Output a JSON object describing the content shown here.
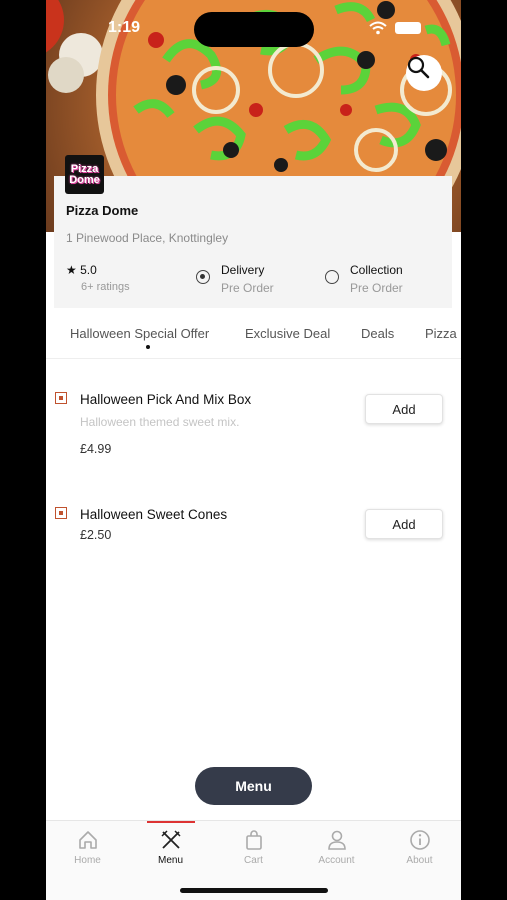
{
  "status": {
    "time": "1:19"
  },
  "restaurant": {
    "logo_text": "Pizza Dome",
    "name": "Pizza Dome",
    "address": "1 Pinewood Place, Knottingley",
    "rating": "5.0",
    "rating_count": "6+ ratings"
  },
  "order_options": [
    {
      "title": "Delivery",
      "subtitle": "Pre Order",
      "selected": true
    },
    {
      "title": "Collection",
      "subtitle": "Pre Order",
      "selected": false
    }
  ],
  "categories": [
    "Halloween Special Offer",
    "Exclusive Deal",
    "Deals",
    "Pizza"
  ],
  "items": [
    {
      "name": "Halloween Pick And Mix Box",
      "description": "Halloween themed sweet mix.",
      "price": "£4.99",
      "button": "Add"
    },
    {
      "name": "Halloween Sweet Cones",
      "description": "",
      "price": "£2.50",
      "button": "Add"
    }
  ],
  "menu_button": "Menu",
  "nav": [
    {
      "label": "Home",
      "icon": "home-icon"
    },
    {
      "label": "Menu",
      "icon": "cutlery-icon",
      "active": true
    },
    {
      "label": "Cart",
      "icon": "bag-icon"
    },
    {
      "label": "Account",
      "icon": "user-icon"
    },
    {
      "label": "About",
      "icon": "info-icon"
    }
  ],
  "colors": {
    "accent": "#d33333",
    "fab": "#353b4a",
    "veg_marker": "#c0522e"
  }
}
